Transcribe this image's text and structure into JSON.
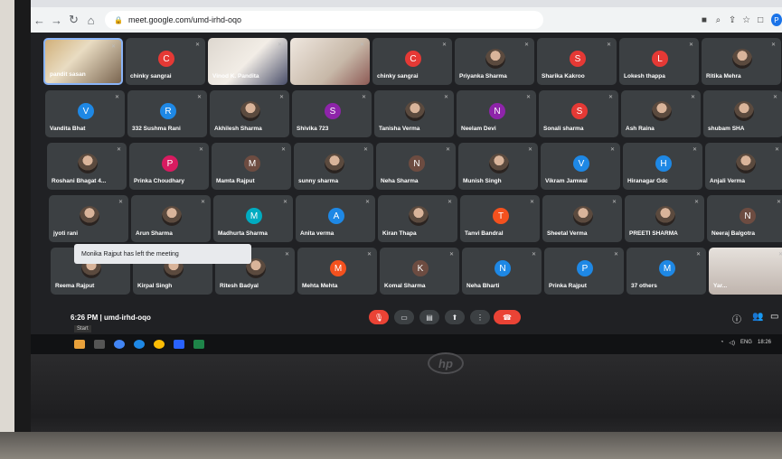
{
  "browser": {
    "url": "meet.google.com/umd-irhd-oqo",
    "profile_initial": "P"
  },
  "participants": [
    {
      "name": "pandit sasan",
      "type": "video",
      "style": "video-a",
      "selected": true
    },
    {
      "name": "chinky sangrai",
      "initial": "C",
      "color": "#e53935"
    },
    {
      "name": "Vinod K. Pandita",
      "type": "video",
      "style": "video-b"
    },
    {
      "name": "",
      "type": "video",
      "style": "video-c"
    },
    {
      "name": "chinky sangrai",
      "initial": "C",
      "color": "#e53935"
    },
    {
      "name": "Priyanka Sharma",
      "type": "pic"
    },
    {
      "name": "Sharika Kakroo",
      "initial": "S",
      "color": "#e53935"
    },
    {
      "name": "Lokesh thappa",
      "initial": "L",
      "color": "#e53935"
    },
    {
      "name": "Ritika Mehra",
      "type": "pic"
    },
    {
      "name": "Vandita Bhat",
      "initial": "V",
      "color": "#1e88e5"
    },
    {
      "name": "332 Sushma Rani",
      "initial": "R",
      "color": "#1e88e5"
    },
    {
      "name": "Akhilesh Sharma",
      "type": "pic"
    },
    {
      "name": "Shivika 723",
      "initial": "S",
      "color": "#8e24aa"
    },
    {
      "name": "Tanisha Verma",
      "type": "pic"
    },
    {
      "name": "Neelam Devi",
      "initial": "N",
      "color": "#8e24aa"
    },
    {
      "name": "Sonali sharma",
      "initial": "S",
      "color": "#e53935"
    },
    {
      "name": "Ash Raina",
      "type": "pic"
    },
    {
      "name": "shubam SHA",
      "type": "pic"
    },
    {
      "name": "Roshani Bhagat 4...",
      "type": "pic"
    },
    {
      "name": "Prinka Choudhary",
      "initial": "P",
      "color": "#d81b60"
    },
    {
      "name": "Mamta Rajput",
      "initial": "M",
      "color": "#6d4c41"
    },
    {
      "name": "sunny sharma",
      "type": "pic"
    },
    {
      "name": "Neha Sharma",
      "initial": "N",
      "color": "#6d4c41"
    },
    {
      "name": "Munish Singh",
      "type": "pic"
    },
    {
      "name": "Vikram Jamwal",
      "initial": "V",
      "color": "#1e88e5"
    },
    {
      "name": "Hiranagar Gdc",
      "initial": "H",
      "color": "#1e88e5"
    },
    {
      "name": "Anjali Verma",
      "type": "pic"
    },
    {
      "name": "jyoti rani",
      "type": "pic"
    },
    {
      "name": "Arun Sharma",
      "type": "pic"
    },
    {
      "name": "Madhurta Sharma",
      "initial": "M",
      "color": "#00acc1"
    },
    {
      "name": "Anita verma",
      "initial": "A",
      "color": "#1e88e5"
    },
    {
      "name": "Kiran Thapa",
      "type": "pic"
    },
    {
      "name": "Tanvi Bandral",
      "initial": "T",
      "color": "#f4511e"
    },
    {
      "name": "Sheetal Verma",
      "type": "pic"
    },
    {
      "name": "PREETI SHARMA",
      "type": "pic"
    },
    {
      "name": "Neeraj Balgotra",
      "initial": "N",
      "color": "#6d4c41"
    },
    {
      "name": "Reema Rajput",
      "type": "pic"
    },
    {
      "name": "Kirpal Singh",
      "type": "pic"
    },
    {
      "name": "Ritesh Badyal",
      "type": "pic"
    },
    {
      "name": "Mehta Mehta",
      "initial": "M",
      "color": "#f4511e"
    },
    {
      "name": "Komal Sharma",
      "initial": "K",
      "color": "#6d4c41"
    },
    {
      "name": "Neha Bharti",
      "initial": "N",
      "color": "#1e88e5"
    },
    {
      "name": "Prinka Rajput",
      "initial": "P",
      "color": "#1e88e5"
    },
    {
      "name": "37 others",
      "initial": "M",
      "color": "#1e88e5"
    },
    {
      "name": "Yar...",
      "type": "video",
      "style": "video-d"
    }
  ],
  "toast": "Monika Rajput has left the meeting",
  "meeting": {
    "time": "6:26 PM",
    "separator": "|",
    "code": "umd-irhd-oqo"
  },
  "taskbar": {
    "start_label": "Start",
    "tray_lang": "ENG",
    "tray_time": "18:26"
  },
  "laptop": {
    "logo": "hp"
  }
}
